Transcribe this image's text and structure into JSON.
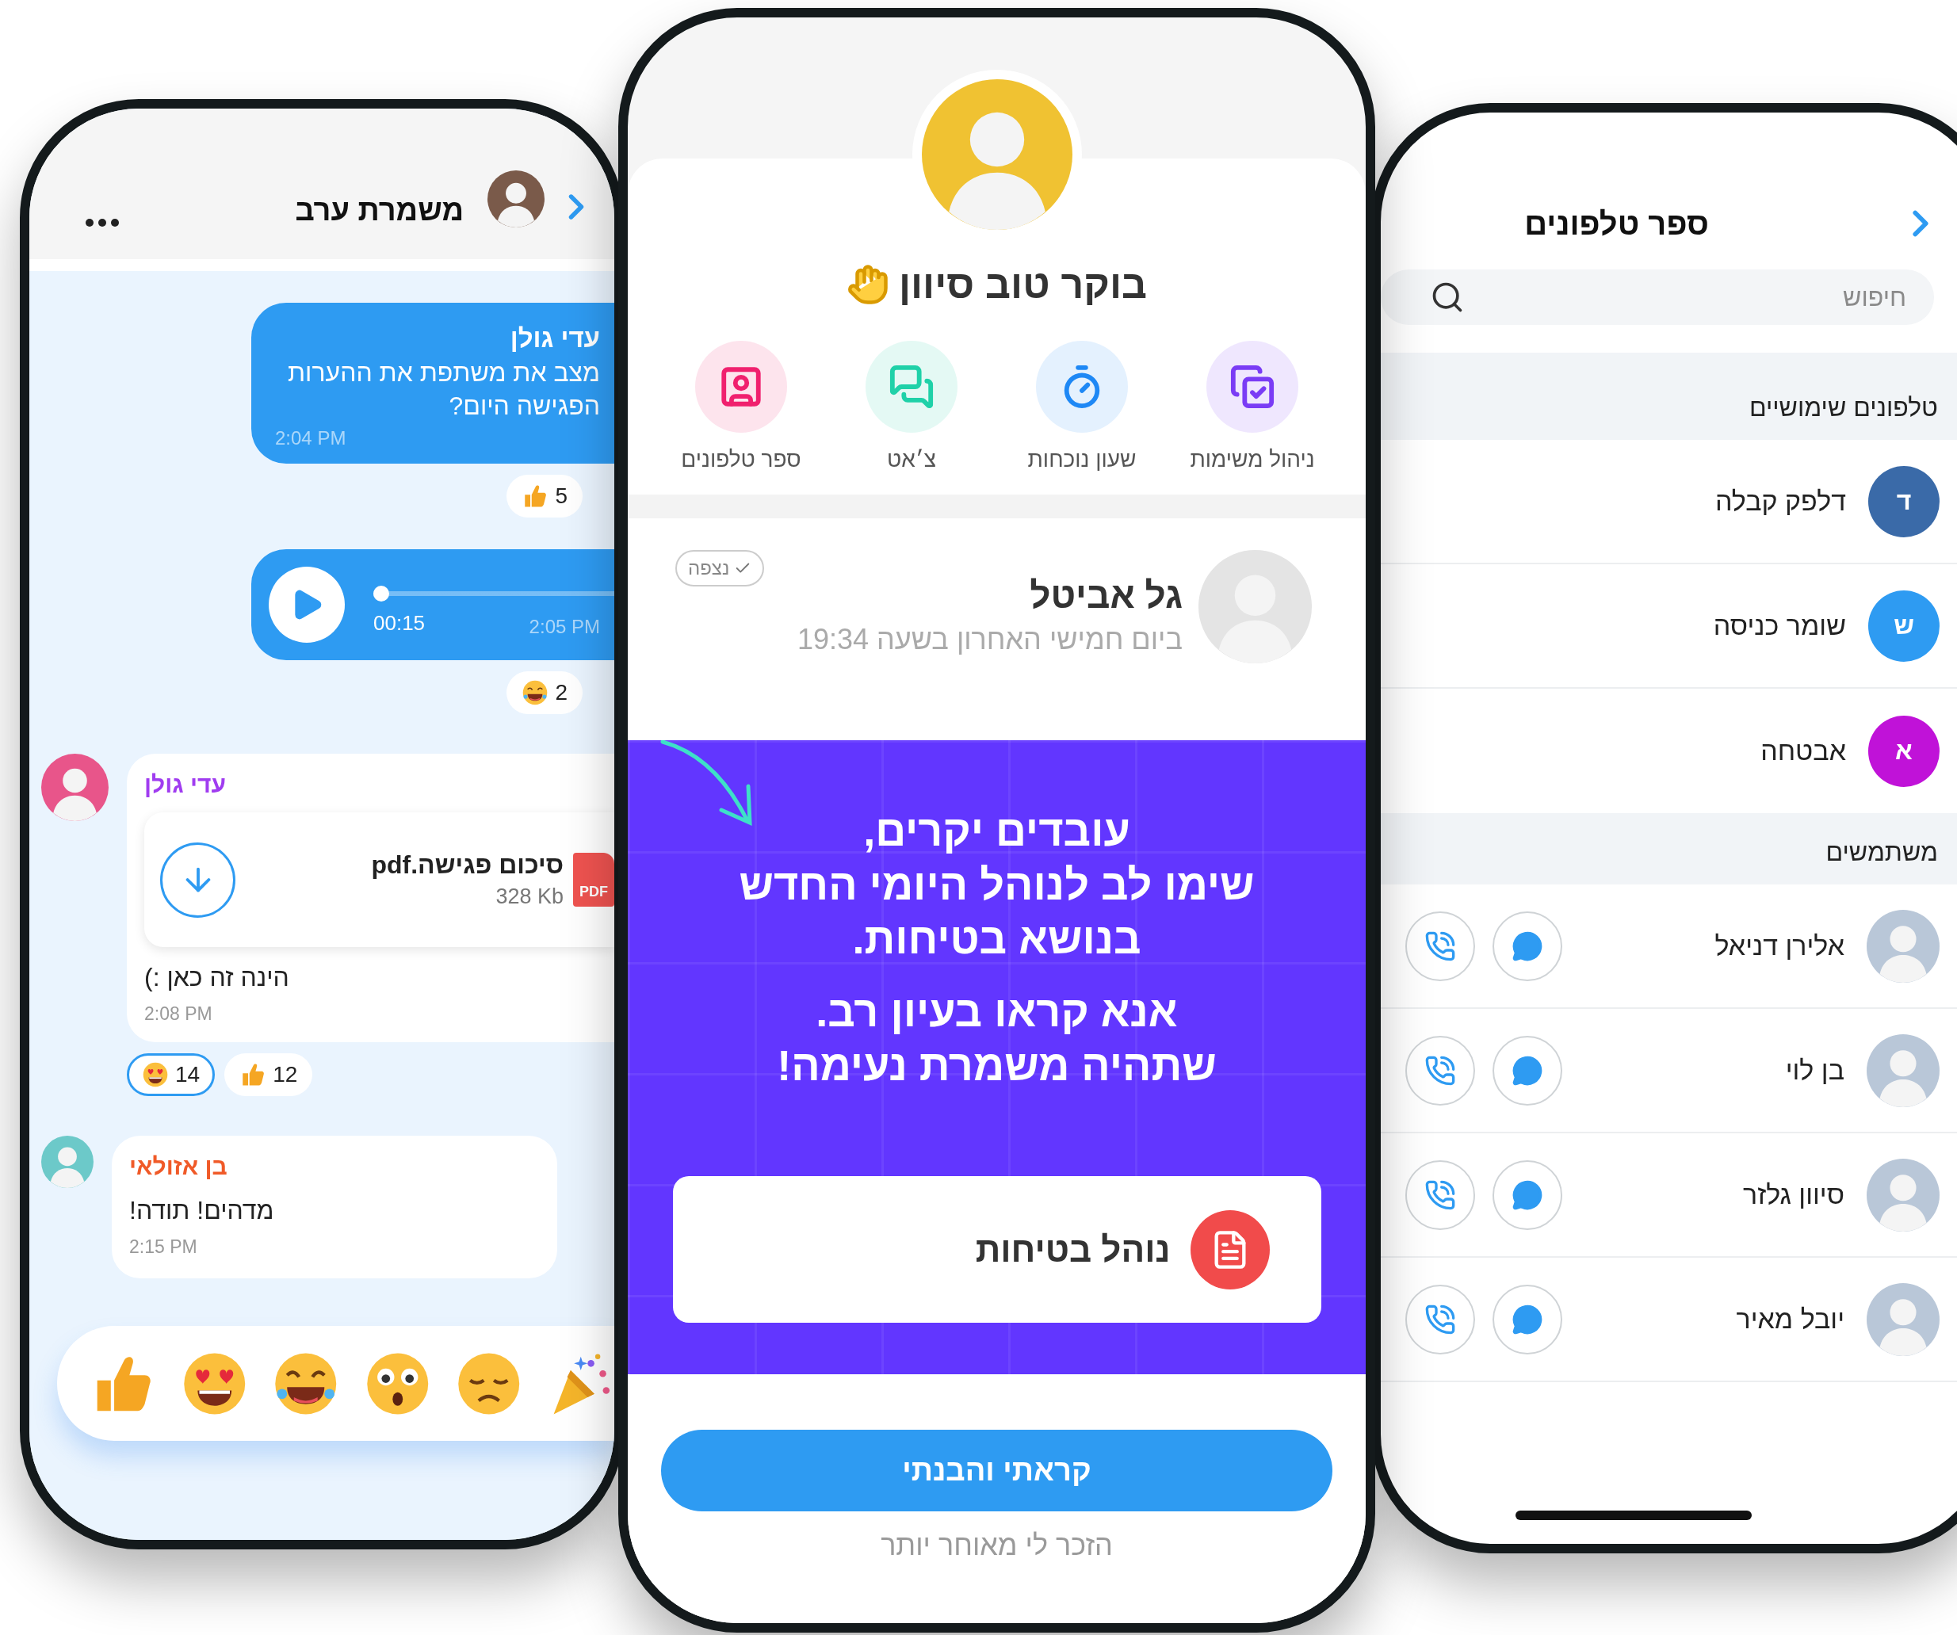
{
  "chat": {
    "title": "משמרת ערב",
    "messages": [
      {
        "kind": "sent-text",
        "sender": "עדי גולן",
        "lines": [
          "מצב את משתפת את ההערות",
          "הפגישה היום?"
        ],
        "time": "2:04 PM",
        "reactions": [
          {
            "kind": "thumbs-up",
            "count": "5",
            "selected": false
          }
        ]
      },
      {
        "kind": "sent-audio",
        "duration": "00:15",
        "time": "2:05 PM",
        "level": 0,
        "reactions": [
          {
            "kind": "laughing",
            "count": "2",
            "selected": false
          }
        ]
      },
      {
        "kind": "received-file",
        "sender": "עדי גולן",
        "color": "#a03cf0",
        "file": {
          "name": "סיכום פגישה.pdf",
          "size": "328 Kb",
          "type": "PDF"
        },
        "text": "הינה זה כאן :)",
        "time": "2:08 PM",
        "reactions": [
          {
            "kind": "thumbs-up",
            "count": "12",
            "selected": false
          },
          {
            "kind": "heart-eyes",
            "count": "14",
            "selected": true
          }
        ]
      },
      {
        "kind": "received-text",
        "sender": "בן אזולאי",
        "color": "#f05a28",
        "text": "מדהים! תודה!",
        "time": "2:15 PM"
      }
    ],
    "reaction_bar": [
      {
        "kind": "thumbs-up"
      },
      {
        "kind": "heart-eyes"
      },
      {
        "kind": "laughing"
      },
      {
        "kind": "surprised"
      },
      {
        "kind": "sad"
      },
      {
        "kind": "party"
      }
    ]
  },
  "home": {
    "greeting": "בוקר טוב סיוון",
    "actions": [
      {
        "kind": "tasks",
        "label": "ניהול משימות",
        "color": "#7a3cf5"
      },
      {
        "kind": "clock",
        "label": "שעון נוכחות",
        "color": "#1e88f5"
      },
      {
        "kind": "chat",
        "label": "צ׳אט",
        "color": "#1fd1a8"
      },
      {
        "kind": "contacts",
        "label": "ספר טלפונים",
        "color": "#f0206e"
      }
    ],
    "announcement": {
      "status": "נצפה",
      "author": "גל אביטל",
      "timestamp": "ביום חמישי האחרון בשעה 19:34",
      "paragraphs": [
        [
          "עובדים יקרים,",
          "שימו לב לנוהל היומי החדש",
          "בנושא בטיחות."
        ],
        [
          "אנא קראו בעיון רב.",
          "שתהיה משמרת נעימה!"
        ]
      ],
      "document": "נוהל בטיחות",
      "confirm_button": "קראתי והבנתי",
      "remind_link": "הזכר לי מאוחר יותר"
    }
  },
  "contacts": {
    "title": "ספר טלפונים",
    "search": {
      "placeholder": "חיפוש"
    },
    "sections": [
      {
        "kind": "letters",
        "title": "טלפונים שימושיים",
        "contacts": [
          {
            "name": "דלפק קבלה",
            "initial": "ד",
            "color": "#3a6aa8"
          },
          {
            "name": "שומר כניסה",
            "initial": "ש",
            "color": "#2e9bf2"
          },
          {
            "name": "אבטחה",
            "initial": "א",
            "color": "#c012d8"
          }
        ]
      },
      {
        "kind": "users",
        "title": "משתמשים",
        "contacts": [
          {
            "name": "אלירן דניאל"
          },
          {
            "name": "בן לוי"
          },
          {
            "name": "סיוון גלזר"
          },
          {
            "name": "יובל מאיר"
          }
        ]
      }
    ]
  }
}
